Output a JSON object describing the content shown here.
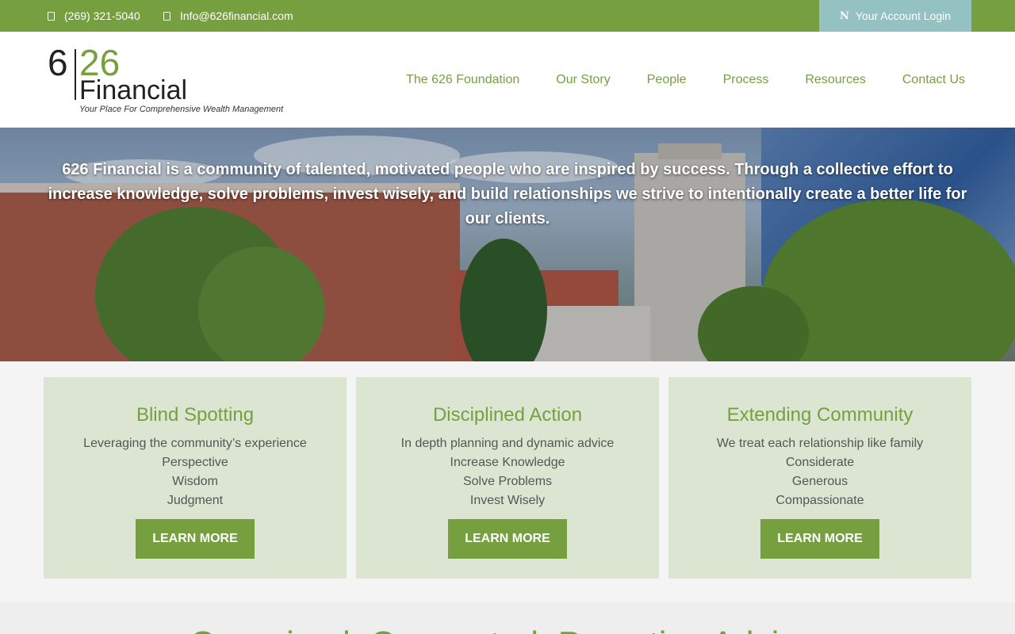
{
  "topbar": {
    "phone": "(269) 321-5040",
    "email": "Info@626financial.com",
    "login_icon": "N",
    "login_label": "Your Account Login"
  },
  "logo": {
    "six": "6",
    "twentysix": "26",
    "financial": "Financial",
    "tagline": "Your Place For Comprehensive Wealth Management"
  },
  "nav": {
    "items": [
      {
        "label": "The 626 Foundation"
      },
      {
        "label": "Our Story"
      },
      {
        "label": "People"
      },
      {
        "label": "Process"
      },
      {
        "label": "Resources"
      },
      {
        "label": "Contact Us"
      }
    ]
  },
  "hero": {
    "text": "626 Financial is a community of talented, motivated people who are inspired by success. Through a collective effort to increase knowledge, solve problems, invest wisely, and build relationships we strive to intentionally create a better life for our clients."
  },
  "cards": [
    {
      "title": "Blind Spotting",
      "lines": [
        "Leveraging the community’s experience",
        "Perspective",
        "Wisdom",
        "Judgment"
      ],
      "button": "LEARN MORE"
    },
    {
      "title": "Disciplined Action",
      "lines": [
        "In depth planning and dynamic advice",
        "Increase Knowledge",
        "Solve Problems",
        "Invest Wisely"
      ],
      "button": "LEARN MORE"
    },
    {
      "title": "Extending Community",
      "lines": [
        "We treat each relationship like family",
        "Considerate",
        "Generous",
        "Compassionate"
      ],
      "button": "LEARN MORE"
    }
  ],
  "bottom": {
    "heading": "Organized. Connected. Proactive Advice."
  },
  "colors": {
    "brand_green": "#76a03f",
    "login_teal": "#94c2c2",
    "card_bg": "#dce5d2"
  }
}
